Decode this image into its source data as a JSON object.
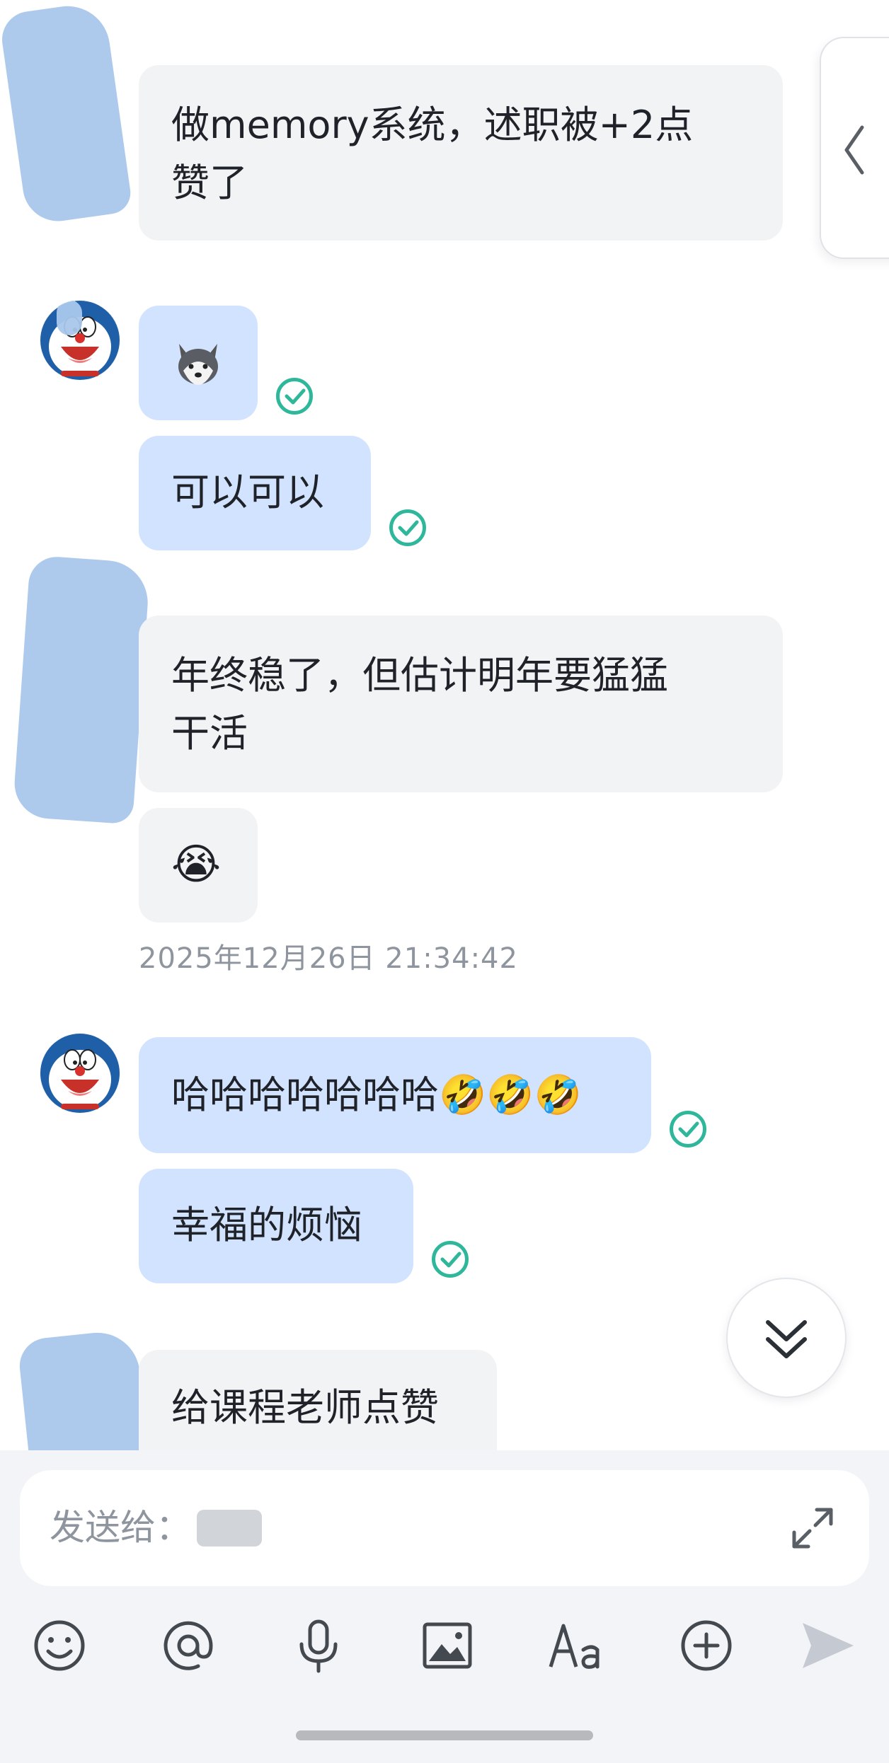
{
  "messages": [
    {
      "id": "m1",
      "direction": "incoming",
      "text": "做memory系统，述职被+2点赞了"
    },
    {
      "id": "m2",
      "direction": "outgoing",
      "type": "sticker",
      "sticker": "husky-dog-emoji"
    },
    {
      "id": "m3",
      "direction": "outgoing",
      "text": "可以可以"
    },
    {
      "id": "m4",
      "direction": "incoming",
      "text": "年终稳了，但估计明年要猛猛干活"
    },
    {
      "id": "m5",
      "direction": "incoming",
      "type": "emoji",
      "emoji": "😭"
    },
    {
      "id": "m6",
      "direction": "outgoing",
      "text": "哈哈哈哈哈哈哈🤣🤣🤣"
    },
    {
      "id": "m7",
      "direction": "outgoing",
      "text": "幸福的烦恼"
    },
    {
      "id": "m8",
      "direction": "incoming",
      "text": "给课程老师点赞"
    }
  ],
  "m1_lines": [
    "做memory系统，述职被+2点",
    "赞了"
  ],
  "m4_lines": [
    "年终稳了，但估计明年要猛猛",
    "干活"
  ],
  "timestamp": "2025年12月26日 21:34:42",
  "composer": {
    "placeholder": "发送给："
  },
  "toolbar": [
    "emoji-icon",
    "at-icon",
    "microphone-icon",
    "image-icon",
    "text-format-icon",
    "plus-icon",
    "send-icon"
  ],
  "colors": {
    "incoming_bubble": "#f2f3f5",
    "outgoing_bubble": "#d1e3fe",
    "read_tick": "#2fb79b",
    "timestamp": "#8f959e"
  }
}
